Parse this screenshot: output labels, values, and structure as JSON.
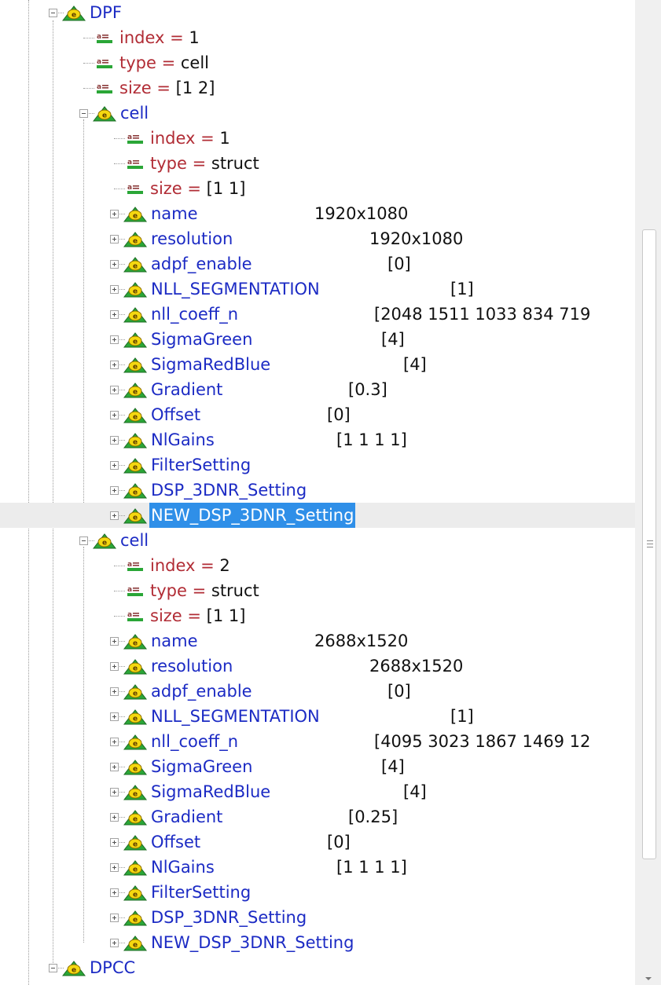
{
  "tree": {
    "rows": [
      {
        "kind": "struct",
        "name": "DPF",
        "value": "",
        "expanded": true
      },
      {
        "kind": "field",
        "name": "index",
        "value": "1"
      },
      {
        "kind": "field",
        "name": "type",
        "value": "cell"
      },
      {
        "kind": "field",
        "name": "size",
        "value": "[1 2]"
      },
      {
        "kind": "struct",
        "name": "cell",
        "value": "",
        "expanded": true
      },
      {
        "kind": "field",
        "name": "index",
        "value": "1"
      },
      {
        "kind": "field",
        "name": "type",
        "value": "struct"
      },
      {
        "kind": "field",
        "name": "size",
        "value": "[1 1]"
      },
      {
        "kind": "struct",
        "name": "name",
        "value": "1920x1080",
        "expanded": false
      },
      {
        "kind": "struct",
        "name": "resolution",
        "value": "1920x1080",
        "expanded": false
      },
      {
        "kind": "struct",
        "name": "adpf_enable",
        "value": "[0]",
        "expanded": false
      },
      {
        "kind": "struct",
        "name": "NLL_SEGMENTATION",
        "value": "[1]",
        "expanded": false
      },
      {
        "kind": "struct",
        "name": "nll_coeff_n",
        "value": "[2048 1511 1033 834 719",
        "expanded": false
      },
      {
        "kind": "struct",
        "name": "SigmaGreen",
        "value": "[4]",
        "expanded": false
      },
      {
        "kind": "struct",
        "name": "SigmaRedBlue",
        "value": "[4]",
        "expanded": false
      },
      {
        "kind": "struct",
        "name": "Gradient",
        "value": "[0.3]",
        "expanded": false
      },
      {
        "kind": "struct",
        "name": "Offset",
        "value": "[0]",
        "expanded": false
      },
      {
        "kind": "struct",
        "name": "NlGains",
        "value": "[1 1 1 1]",
        "expanded": false
      },
      {
        "kind": "struct",
        "name": "FilterSetting",
        "value": "",
        "expanded": false
      },
      {
        "kind": "struct",
        "name": "DSP_3DNR_Setting",
        "value": "",
        "expanded": false
      },
      {
        "kind": "struct",
        "name": "NEW_DSP_3DNR_Setting",
        "value": "",
        "expanded": false,
        "selected": true
      },
      {
        "kind": "struct",
        "name": "cell",
        "value": "",
        "expanded": true
      },
      {
        "kind": "field",
        "name": "index",
        "value": "2"
      },
      {
        "kind": "field",
        "name": "type",
        "value": "struct"
      },
      {
        "kind": "field",
        "name": "size",
        "value": "[1 1]"
      },
      {
        "kind": "struct",
        "name": "name",
        "value": "2688x1520",
        "expanded": false
      },
      {
        "kind": "struct",
        "name": "resolution",
        "value": "2688x1520",
        "expanded": false
      },
      {
        "kind": "struct",
        "name": "adpf_enable",
        "value": "[0]",
        "expanded": false
      },
      {
        "kind": "struct",
        "name": "NLL_SEGMENTATION",
        "value": "[1]",
        "expanded": false
      },
      {
        "kind": "struct",
        "name": "nll_coeff_n",
        "value": "[4095 3023 1867 1469 12",
        "expanded": false
      },
      {
        "kind": "struct",
        "name": "SigmaGreen",
        "value": "[4]",
        "expanded": false
      },
      {
        "kind": "struct",
        "name": "SigmaRedBlue",
        "value": "[4]",
        "expanded": false
      },
      {
        "kind": "struct",
        "name": "Gradient",
        "value": "[0.25]",
        "expanded": false
      },
      {
        "kind": "struct",
        "name": "Offset",
        "value": "[0]",
        "expanded": false
      },
      {
        "kind": "struct",
        "name": "NlGains",
        "value": "[1 1 1 1]",
        "expanded": false
      },
      {
        "kind": "struct",
        "name": "FilterSetting",
        "value": "",
        "expanded": false
      },
      {
        "kind": "struct",
        "name": "DSP_3DNR_Setting",
        "value": "",
        "expanded": false
      },
      {
        "kind": "struct",
        "name": "NEW_DSP_3DNR_Setting",
        "value": "",
        "expanded": false
      },
      {
        "kind": "struct",
        "name": "DPCC",
        "value": "",
        "expanded": true
      }
    ]
  },
  "colors": {
    "struct_label": "#1c2bc4",
    "field_name": "#b12c35",
    "selection": "#2f8fe8",
    "icon_green": "#2aa637",
    "icon_yellow": "#f5d80f"
  },
  "icons": {
    "struct": "struct-node-icon",
    "field": "field-node-icon",
    "expand": "plus-expander-icon",
    "collapse": "minus-expander-icon"
  }
}
